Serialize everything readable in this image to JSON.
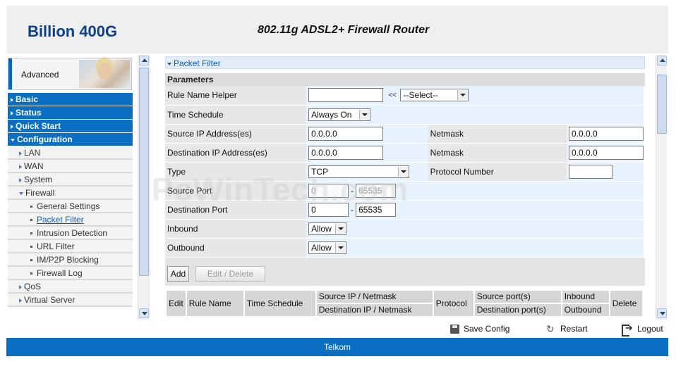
{
  "header": {
    "brand": "Billion 400G",
    "product": "802.11g ADSL2+ Firewall Router"
  },
  "sidebar": {
    "advanced_label": "Advanced",
    "items": [
      {
        "label": "Basic",
        "level": 1,
        "expanded": false
      },
      {
        "label": "Status",
        "level": 1,
        "expanded": false
      },
      {
        "label": "Quick Start",
        "level": 1,
        "expanded": false
      },
      {
        "label": "Configuration",
        "level": 1,
        "expanded": true
      },
      {
        "label": "LAN",
        "level": 2,
        "expanded": false
      },
      {
        "label": "WAN",
        "level": 2,
        "expanded": false
      },
      {
        "label": "System",
        "level": 2,
        "expanded": false
      },
      {
        "label": "Firewall",
        "level": 2,
        "expanded": true
      },
      {
        "label": "General Settings",
        "level": 3
      },
      {
        "label": "Packet Filter",
        "level": 3,
        "active": true
      },
      {
        "label": "Intrusion Detection",
        "level": 3
      },
      {
        "label": "URL Filter",
        "level": 3
      },
      {
        "label": "IM/P2P Blocking",
        "level": 3
      },
      {
        "label": "Firewall Log",
        "level": 3
      },
      {
        "label": "QoS",
        "level": 2,
        "expanded": false
      },
      {
        "label": "Virtual Server",
        "level": 2,
        "expanded": false
      }
    ]
  },
  "main": {
    "panel_title": "Packet Filter",
    "parameters_heading": "Parameters",
    "fields": {
      "rule_name_helper": {
        "label": "Rule Name  Helper",
        "value": "",
        "separator": "<<",
        "select": "--Select--"
      },
      "time_schedule": {
        "label": "Time Schedule",
        "select": "Always On"
      },
      "source_ip": {
        "label": "Source IP Address(es)",
        "value": "0.0.0.0",
        "netmask_label": "Netmask",
        "netmask": "0.0.0.0"
      },
      "dest_ip": {
        "label": "Destination IP Address(es)",
        "value": "0.0.0.0",
        "netmask_label": "Netmask",
        "netmask": "0.0.0.0"
      },
      "type": {
        "label": "Type",
        "select": "TCP",
        "protocol_label": "Protocol Number",
        "protocol_value": ""
      },
      "source_port": {
        "label": "Source Port",
        "from": "0",
        "to": "65535"
      },
      "dest_port": {
        "label": "Destination Port",
        "from": "0",
        "to": "65535"
      },
      "inbound": {
        "label": "Inbound",
        "select": "Allow"
      },
      "outbound": {
        "label": "Outbound",
        "select": "Allow"
      }
    },
    "buttons": {
      "add": "Add",
      "edit_delete": "Edit / Delete"
    },
    "rules_table": {
      "edit": "Edit",
      "rule_name": "Rule Name",
      "time_schedule": "Time Schedule",
      "source_ip_netmask": "Source IP / Netmask",
      "dest_ip_netmask": "Destination IP / Netmask",
      "protocol": "Protocol",
      "source_ports": "Source port(s)",
      "dest_ports": "Destination port(s)",
      "inbound": "Inbound",
      "outbound": "Outbound",
      "delete": "Delete"
    }
  },
  "actions": {
    "save": "Save Config",
    "restart": "Restart",
    "logout": "Logout"
  },
  "footer": {
    "text": "Telkom"
  },
  "watermark": "PcWinTech.com",
  "colors": {
    "brand": "#0a3f8a",
    "nav": "#0a6fc2",
    "link": "#0a5ac0"
  }
}
